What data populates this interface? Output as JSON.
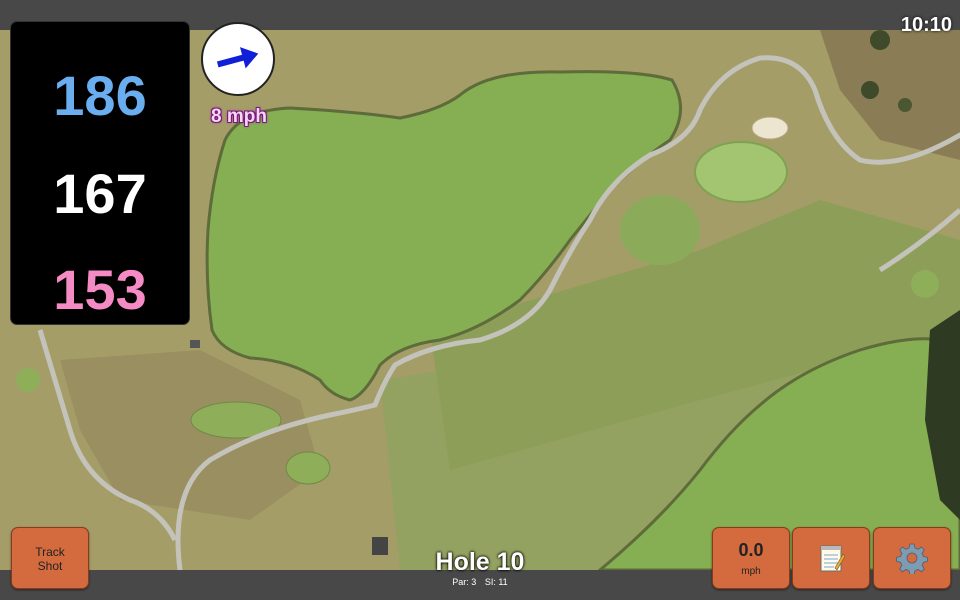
{
  "status_bar": {
    "time": "10:10"
  },
  "yardages": {
    "back": "186",
    "middle": "167",
    "front": "153"
  },
  "wind": {
    "speed_label": "8 mph",
    "arrow_icon": "arrow-right-icon"
  },
  "buttons": {
    "track_shot_line1": "Track",
    "track_shot_line2": "Shot",
    "speed_value": "0.0",
    "speed_unit": "mph",
    "notes_icon": "notepad-icon",
    "settings_icon": "gear-icon"
  },
  "hole": {
    "title": "Hole 10",
    "par": "Par: 3",
    "si": "SI: 11"
  },
  "colors": {
    "back_yardage": "#6aaef0",
    "middle_yardage": "#ffffff",
    "front_yardage": "#f58bc4",
    "button_orange": "#d46b3e",
    "wind_arrow": "#1020d8",
    "wind_text_outline": "#7a1680"
  }
}
